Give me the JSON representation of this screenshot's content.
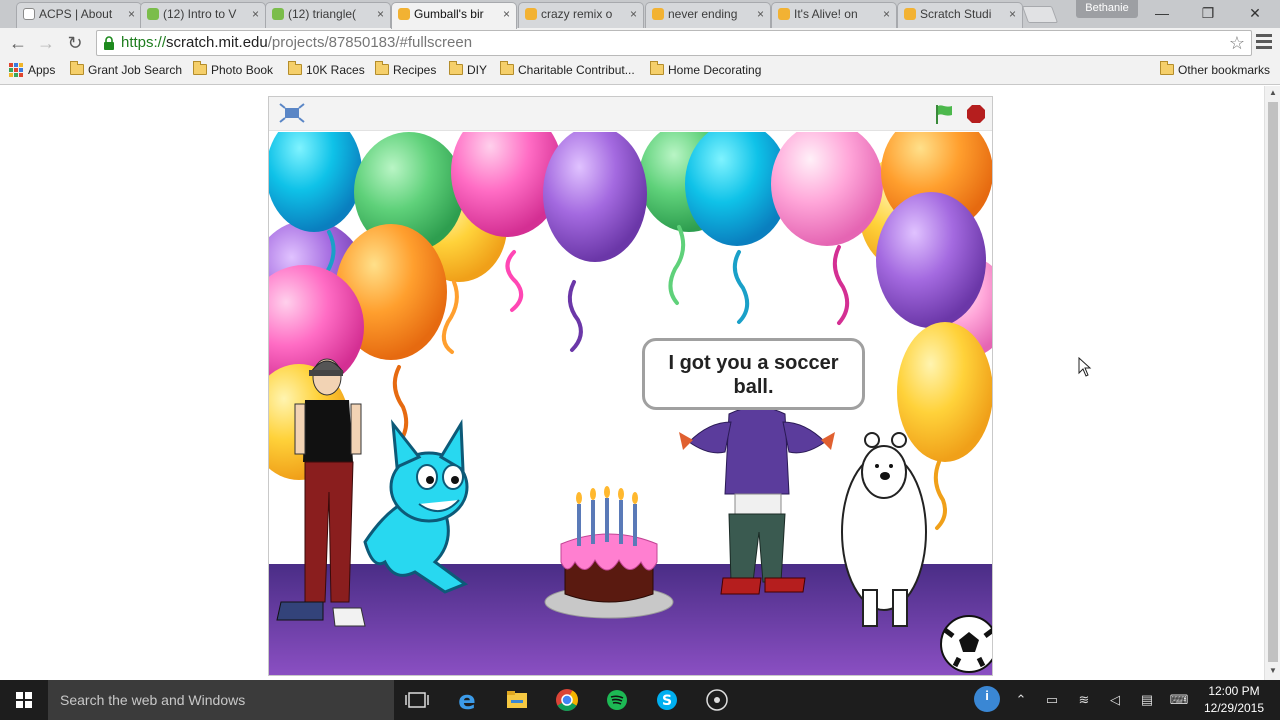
{
  "browser": {
    "tabs": [
      {
        "title": "ACPS | About",
        "favicon": "page"
      },
      {
        "title": "(12) Intro to V",
        "favicon": "leaf"
      },
      {
        "title": "(12) triangle(",
        "favicon": "leaf"
      },
      {
        "title": "Gumball's bir",
        "favicon": "scratch",
        "active": true
      },
      {
        "title": "crazy remix o",
        "favicon": "scratch"
      },
      {
        "title": "never ending",
        "favicon": "scratch"
      },
      {
        "title": "It's Alive! on",
        "favicon": "scratch"
      },
      {
        "title": "Scratch Studi",
        "favicon": "scratch"
      }
    ],
    "tab_close_glyph": "×",
    "profile_name": "Bethanie",
    "window_buttons": {
      "minimize": "—",
      "restore": "❐",
      "close": "✕"
    },
    "nav": {
      "back": "←",
      "forward": "→",
      "reload": "↻"
    },
    "url": {
      "scheme": "https://",
      "host": "scratch.mit.edu",
      "path": "/projects/87850183/#fullscreen"
    },
    "star_glyph": "☆"
  },
  "bookmarks": {
    "apps_label": "Apps",
    "items": [
      "Grant Job Search",
      "Photo Book",
      "10K Races",
      "Recipes",
      "DIY",
      "Charitable Contribut...",
      "Home Decorating"
    ],
    "other_label": "Other bookmarks"
  },
  "scratch_player": {
    "speech_text": "I got you a soccer ball.",
    "colors": {
      "flag": "#4cb84c",
      "stop": "#b51e1e",
      "floor": "#5f3a9c"
    }
  },
  "taskbar": {
    "search_placeholder": "Search the web and Windows",
    "time": "12:00 PM",
    "date": "12/29/2015",
    "notification_badge": "i"
  }
}
